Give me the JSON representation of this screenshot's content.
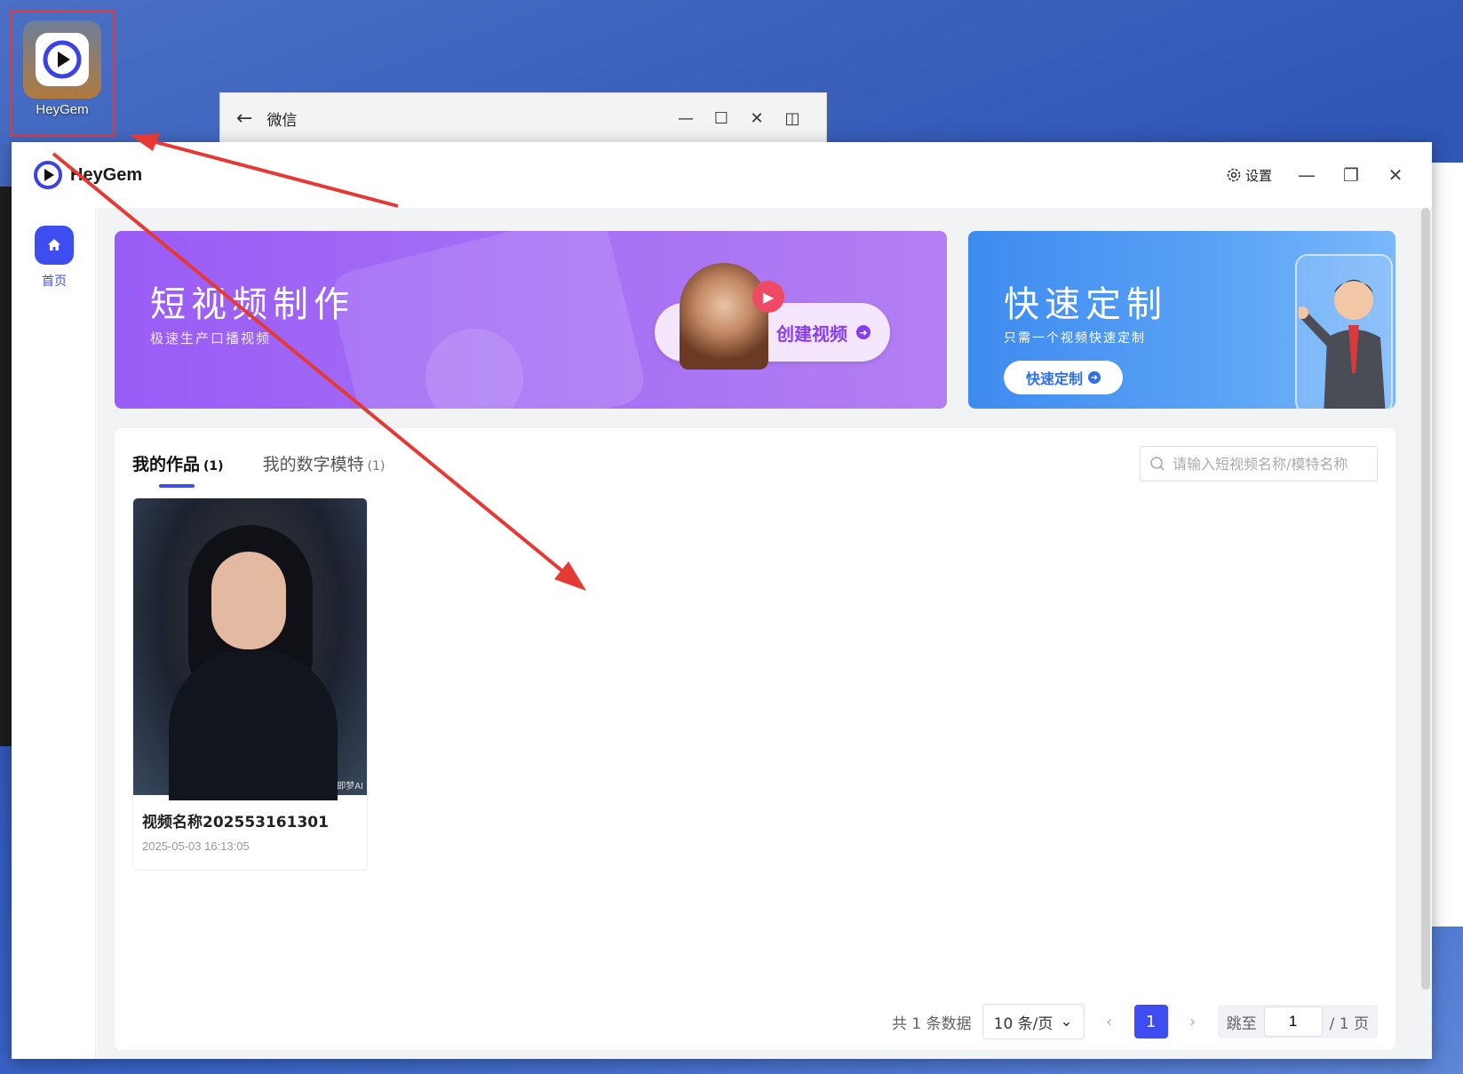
{
  "desktop": {
    "icon_label": "HeyGem"
  },
  "wechat": {
    "title": "微信",
    "back": "←",
    "ctrl_min": "—",
    "ctrl_max": "☐",
    "ctrl_close": "✕",
    "ctrl_side": "◫"
  },
  "app": {
    "brand": "HeyGem",
    "settings_label": "设置",
    "win_min": "—",
    "win_restore": "❐",
    "win_close": "✕"
  },
  "sidebar": {
    "items": [
      {
        "label": "首页",
        "icon": "home-icon"
      }
    ]
  },
  "banners": {
    "short_video": {
      "title": "短视频制作",
      "subtitle": "极速生产口播视频",
      "button": "创建视频"
    },
    "quick_custom": {
      "title": "快速定制",
      "subtitle": "只需一个视频快速定制",
      "button": "快速定制"
    }
  },
  "tabs": [
    {
      "label": "我的作品",
      "count": "(1)",
      "active": true
    },
    {
      "label": "我的数字模特",
      "count": "(1)",
      "active": false
    }
  ],
  "search": {
    "placeholder": "请输入短视频名称/模特名称"
  },
  "works": [
    {
      "name": "视频名称202553161301",
      "time": "2025-05-03 16:13:05",
      "watermark": "即梦AI"
    }
  ],
  "pagination": {
    "total_text": "共 1 条数据",
    "page_size": "10 条/页",
    "current_page": "1",
    "jump_label": "跳至",
    "jump_value": "1",
    "total_pages": "/ 1 页"
  },
  "colors": {
    "accent": "#3e4df0",
    "banner_purple": "#9a5cf6",
    "banner_blue": "#3e8bf0",
    "annotation": "#e53935"
  }
}
